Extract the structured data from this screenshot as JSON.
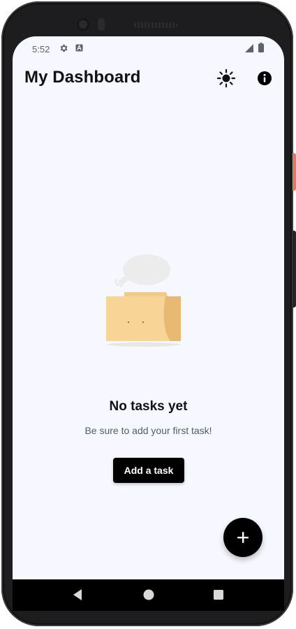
{
  "status_bar": {
    "time": "5:52",
    "icons": [
      "gear-icon",
      "a-icon",
      "signal-icon",
      "battery-icon"
    ]
  },
  "header": {
    "title": "My Dashboard",
    "actions": [
      "sun-icon",
      "info-icon"
    ]
  },
  "empty_state": {
    "illustration": "folder-with-speech-bubble",
    "title": "No tasks yet",
    "subtitle": "Be sure to add your first task!",
    "button_label": "Add a task"
  },
  "fab": {
    "icon": "plus-icon"
  },
  "navigation_bar": {
    "buttons": [
      "back-icon",
      "home-icon",
      "recents-icon"
    ]
  },
  "colors": {
    "screen_background": "#f5f8ff",
    "primary": "#000000",
    "title_text": "#111111",
    "subtitle_text": "#555a60",
    "illustration_folder": "#f8d496",
    "illustration_folder_back": "#e8b972",
    "illustration_bubble": "#ececec"
  }
}
